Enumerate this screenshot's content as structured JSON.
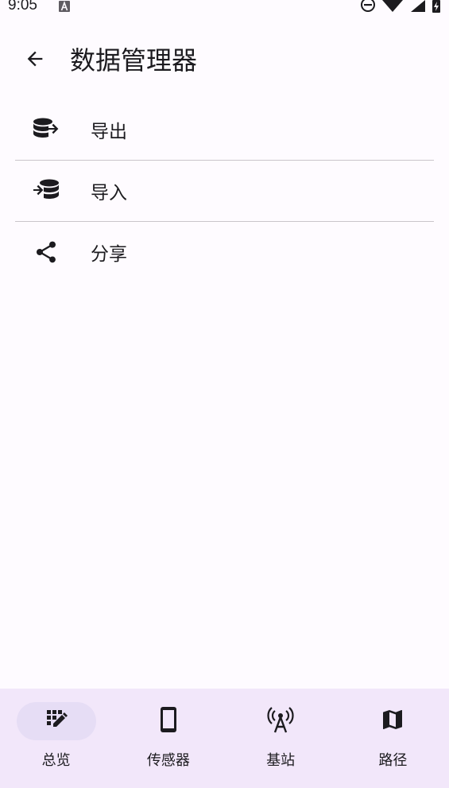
{
  "status_bar": {
    "time": "9:05"
  },
  "top_bar": {
    "title": "数据管理器"
  },
  "menu": {
    "items": [
      {
        "label": "导出",
        "icon": "database-export-icon"
      },
      {
        "label": "导入",
        "icon": "database-import-icon"
      },
      {
        "label": "分享",
        "icon": "share-icon"
      }
    ]
  },
  "bottom_nav": {
    "active_index": 0,
    "items": [
      {
        "label": "总览",
        "icon": "overview-grid-edit-icon"
      },
      {
        "label": "传感器",
        "icon": "phone-icon"
      },
      {
        "label": "基站",
        "icon": "cell-tower-icon"
      },
      {
        "label": "路径",
        "icon": "map-icon"
      }
    ]
  },
  "colors": {
    "background": "#fefbff",
    "nav_background": "#f2e7fa",
    "nav_active_pill": "#e6ddf5",
    "text": "#1c1b1f",
    "divider": "#c9c5ca"
  }
}
